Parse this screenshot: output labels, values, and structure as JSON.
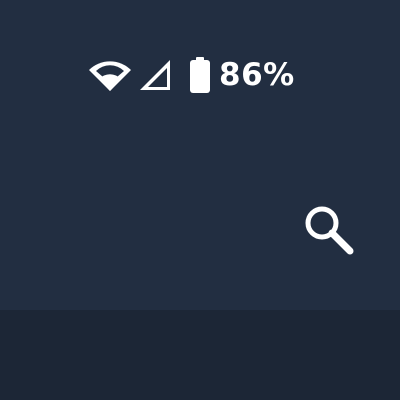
{
  "status_bar": {
    "wifi_icon": "wifi-icon",
    "signal_icon": "cell-signal-icon",
    "battery_icon": "battery-icon",
    "battery_level_text": "86%",
    "battery_level": 0.86
  },
  "app_bar": {
    "search_icon": "search-icon"
  },
  "colors": {
    "background": "#212d40",
    "bottom_panel": "#1c2636",
    "foreground": "#ffffff"
  }
}
